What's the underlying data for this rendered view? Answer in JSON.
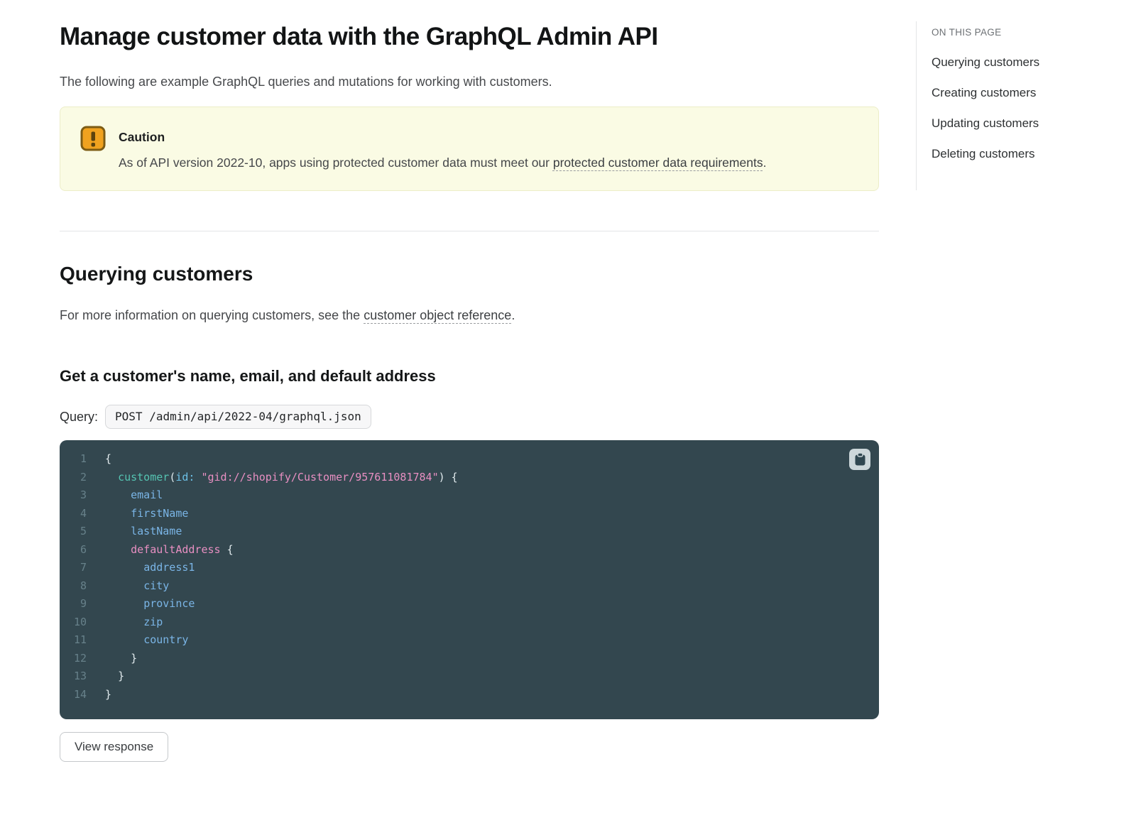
{
  "page": {
    "title": "Manage customer data with the GraphQL Admin API",
    "intro": "The following are example GraphQL queries and mutations for working with customers."
  },
  "caution": {
    "title": "Caution",
    "text_before": "As of API version 2022-10, apps using protected customer data must meet our ",
    "link_text": "protected customer data requirements",
    "text_after": "."
  },
  "querying": {
    "heading": "Querying customers",
    "para_before": "For more information on querying customers, see the ",
    "para_link": "customer object reference",
    "para_after": ".",
    "subsection": "Get a customer's name, email, and default address",
    "query_label": "Query:",
    "endpoint": "POST /admin/api/2022-04/graphql.json",
    "view_response_label": "View response"
  },
  "code": {
    "lines": [
      {
        "num": "1",
        "tokens": [
          {
            "c": "punc",
            "v": "{"
          }
        ]
      },
      {
        "num": "2",
        "tokens": [
          {
            "c": "plain",
            "v": "  "
          },
          {
            "c": "keyword",
            "v": "customer"
          },
          {
            "c": "punc",
            "v": "("
          },
          {
            "c": "attr",
            "v": "id:"
          },
          {
            "c": "plain",
            "v": " "
          },
          {
            "c": "string",
            "v": "\"gid://shopify/Customer/957611081784\""
          },
          {
            "c": "punc",
            "v": ") {"
          }
        ]
      },
      {
        "num": "3",
        "tokens": [
          {
            "c": "plain",
            "v": "    "
          },
          {
            "c": "field",
            "v": "email"
          }
        ]
      },
      {
        "num": "4",
        "tokens": [
          {
            "c": "plain",
            "v": "    "
          },
          {
            "c": "field",
            "v": "firstName"
          }
        ]
      },
      {
        "num": "5",
        "tokens": [
          {
            "c": "plain",
            "v": "    "
          },
          {
            "c": "field",
            "v": "lastName"
          }
        ]
      },
      {
        "num": "6",
        "tokens": [
          {
            "c": "plain",
            "v": "    "
          },
          {
            "c": "pink",
            "v": "defaultAddress"
          },
          {
            "c": "punc",
            "v": " {"
          }
        ]
      },
      {
        "num": "7",
        "tokens": [
          {
            "c": "plain",
            "v": "      "
          },
          {
            "c": "field",
            "v": "address1"
          }
        ]
      },
      {
        "num": "8",
        "tokens": [
          {
            "c": "plain",
            "v": "      "
          },
          {
            "c": "field",
            "v": "city"
          }
        ]
      },
      {
        "num": "9",
        "tokens": [
          {
            "c": "plain",
            "v": "      "
          },
          {
            "c": "field",
            "v": "province"
          }
        ]
      },
      {
        "num": "10",
        "tokens": [
          {
            "c": "plain",
            "v": "      "
          },
          {
            "c": "field",
            "v": "zip"
          }
        ]
      },
      {
        "num": "11",
        "tokens": [
          {
            "c": "plain",
            "v": "      "
          },
          {
            "c": "field",
            "v": "country"
          }
        ]
      },
      {
        "num": "12",
        "tokens": [
          {
            "c": "plain",
            "v": "    "
          },
          {
            "c": "punc",
            "v": "}"
          }
        ]
      },
      {
        "num": "13",
        "tokens": [
          {
            "c": "plain",
            "v": "  "
          },
          {
            "c": "punc",
            "v": "}"
          }
        ]
      },
      {
        "num": "14",
        "tokens": [
          {
            "c": "punc",
            "v": "}"
          }
        ]
      }
    ]
  },
  "toc": {
    "title": "ON THIS PAGE",
    "items": [
      {
        "id": "querying-customers",
        "label": "Querying customers"
      },
      {
        "id": "creating-customers",
        "label": "Creating customers"
      },
      {
        "id": "updating-customers",
        "label": "Updating customers"
      },
      {
        "id": "deleting-customers",
        "label": "Deleting customers"
      }
    ]
  },
  "colors": {
    "code_background": "#33474f",
    "caution_background": "#fafbe4",
    "syntax_teal": "#55c4b2",
    "syntax_blue": "#7ab5e6",
    "syntax_pink": "#e88fc2",
    "warning_icon_orange": "#f0a21f"
  }
}
